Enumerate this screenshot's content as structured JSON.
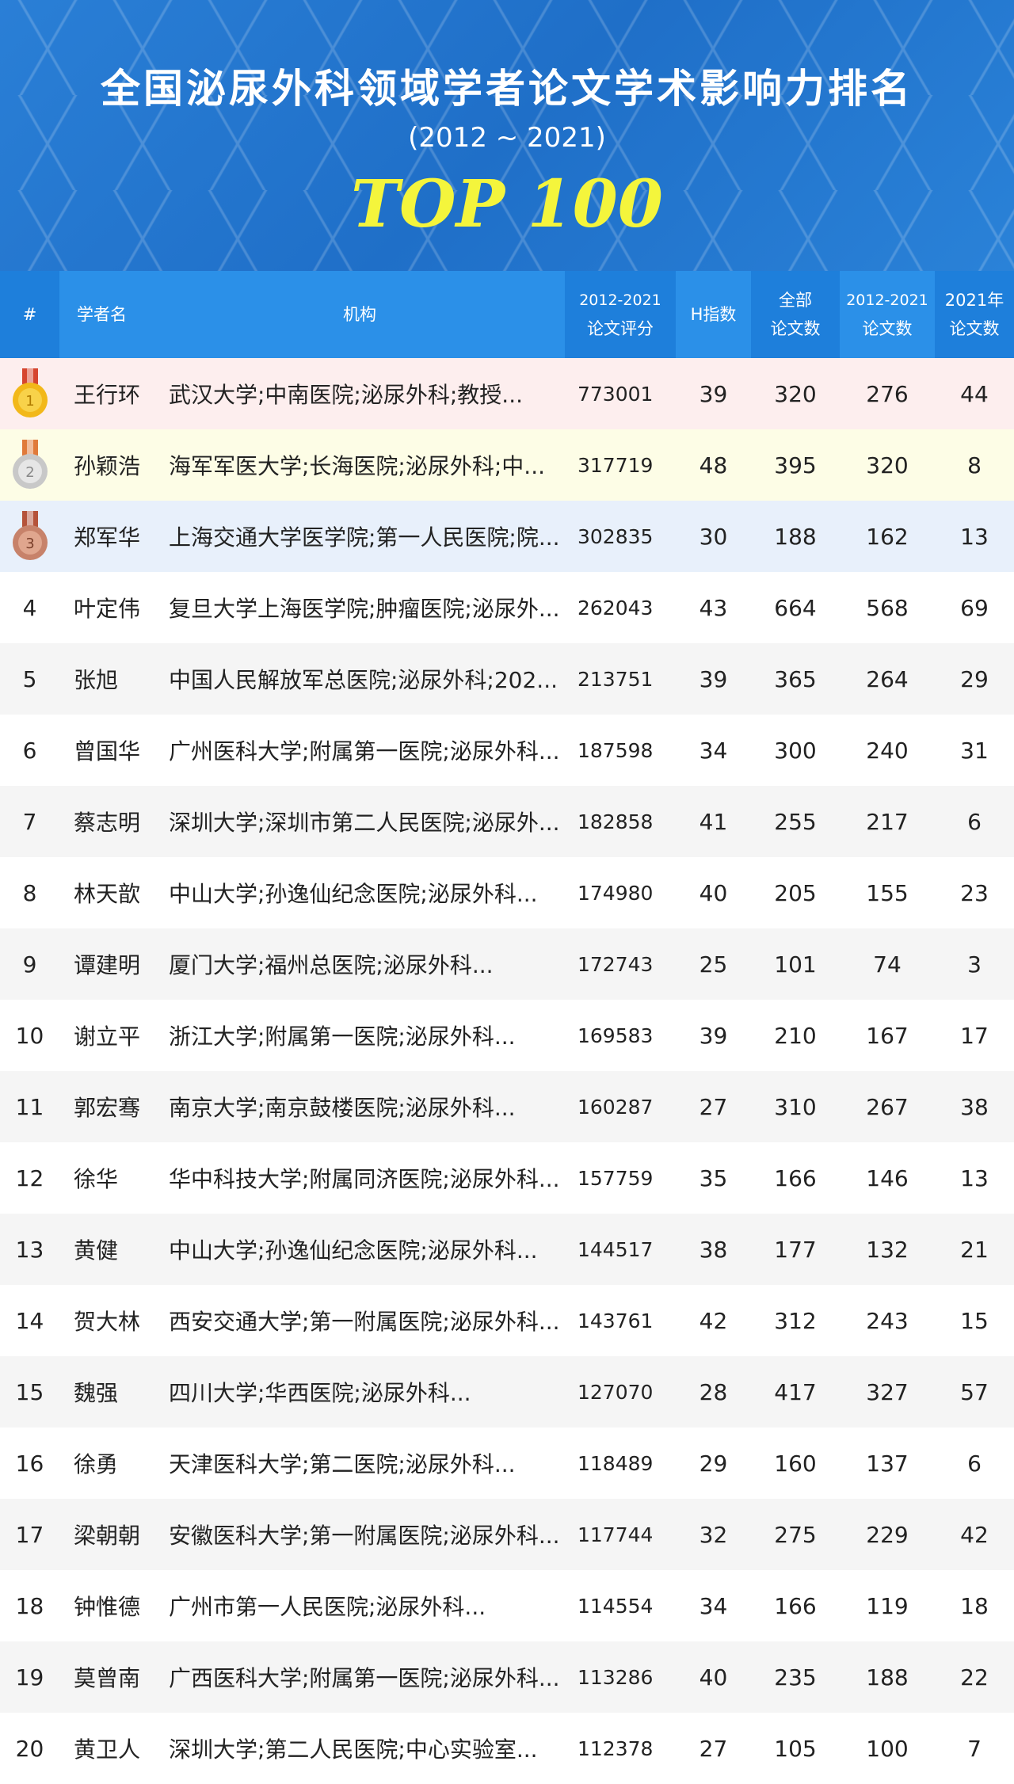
{
  "banner": {
    "title": "全国泌尿外科领域学者论文学术影响力排名",
    "subtitle": "(2012 ~ 2021)",
    "top_label": "TOP 100"
  },
  "colors": {
    "header_bg": "#2b90e8",
    "header_dark": "#1e7fdb",
    "top_text": "#f4f53c",
    "gold_row": "#fdeeee",
    "silver_row": "#fdfde6",
    "bronze_row": "#e8f0fb"
  },
  "table": {
    "headers": {
      "rank": "#",
      "name": "学者名",
      "institution": "机构",
      "score_l1": "2012-2021",
      "score_l2": "论文评分",
      "h_index": "H指数",
      "total_l1": "全部",
      "total_l2": "论文数",
      "period_l1": "2012-2021",
      "period_l2": "论文数",
      "year_l1": "2021年",
      "year_l2": "论文数"
    },
    "rows": [
      {
        "rank": "1",
        "medal": "gold-medal-icon",
        "name": "王行环",
        "institution": "武汉大学;中南医院;泌尿外科;教授...",
        "score": "773001",
        "h_index": "39",
        "total": "320",
        "period": "276",
        "year2021": "44"
      },
      {
        "rank": "2",
        "medal": "silver-medal-icon",
        "name": "孙颖浩",
        "institution": "海军军医大学;长海医院;泌尿外科;中...",
        "score": "317719",
        "h_index": "48",
        "total": "395",
        "period": "320",
        "year2021": "8"
      },
      {
        "rank": "3",
        "medal": "bronze-medal-icon",
        "name": "郑军华",
        "institution": "上海交通大学医学院;第一人民医院;院...",
        "score": "302835",
        "h_index": "30",
        "total": "188",
        "period": "162",
        "year2021": "13"
      },
      {
        "rank": "4",
        "name": "叶定伟",
        "institution": "复旦大学上海医学院;肿瘤医院;泌尿外...",
        "score": "262043",
        "h_index": "43",
        "total": "664",
        "period": "568",
        "year2021": "69"
      },
      {
        "rank": "5",
        "name": "张旭",
        "institution": "中国人民解放军总医院;泌尿外科;202...",
        "score": "213751",
        "h_index": "39",
        "total": "365",
        "period": "264",
        "year2021": "29"
      },
      {
        "rank": "6",
        "name": "曾国华",
        "institution": "广州医科大学;附属第一医院;泌尿外科...",
        "score": "187598",
        "h_index": "34",
        "total": "300",
        "period": "240",
        "year2021": "31"
      },
      {
        "rank": "7",
        "name": "蔡志明",
        "institution": "深圳大学;深圳市第二人民医院;泌尿外...",
        "score": "182858",
        "h_index": "41",
        "total": "255",
        "period": "217",
        "year2021": "6"
      },
      {
        "rank": "8",
        "name": "林天歆",
        "institution": "中山大学;孙逸仙纪念医院;泌尿外科...",
        "score": "174980",
        "h_index": "40",
        "total": "205",
        "period": "155",
        "year2021": "23"
      },
      {
        "rank": "9",
        "name": "谭建明",
        "institution": "厦门大学;福州总医院;泌尿外科...",
        "score": "172743",
        "h_index": "25",
        "total": "101",
        "period": "74",
        "year2021": "3"
      },
      {
        "rank": "10",
        "name": "谢立平",
        "institution": "浙江大学;附属第一医院;泌尿外科...",
        "score": "169583",
        "h_index": "39",
        "total": "210",
        "period": "167",
        "year2021": "17"
      },
      {
        "rank": "11",
        "name": "郭宏骞",
        "institution": "南京大学;南京鼓楼医院;泌尿外科...",
        "score": "160287",
        "h_index": "27",
        "total": "310",
        "period": "267",
        "year2021": "38"
      },
      {
        "rank": "12",
        "name": "徐华",
        "institution": "华中科技大学;附属同济医院;泌尿外科...",
        "score": "157759",
        "h_index": "35",
        "total": "166",
        "period": "146",
        "year2021": "13"
      },
      {
        "rank": "13",
        "name": "黄健",
        "institution": "中山大学;孙逸仙纪念医院;泌尿外科...",
        "score": "144517",
        "h_index": "38",
        "total": "177",
        "period": "132",
        "year2021": "21"
      },
      {
        "rank": "14",
        "name": "贺大林",
        "institution": "西安交通大学;第一附属医院;泌尿外科...",
        "score": "143761",
        "h_index": "42",
        "total": "312",
        "period": "243",
        "year2021": "15"
      },
      {
        "rank": "15",
        "name": "魏强",
        "institution": "四川大学;华西医院;泌尿外科...",
        "score": "127070",
        "h_index": "28",
        "total": "417",
        "period": "327",
        "year2021": "57"
      },
      {
        "rank": "16",
        "name": "徐勇",
        "institution": "天津医科大学;第二医院;泌尿外科...",
        "score": "118489",
        "h_index": "29",
        "total": "160",
        "period": "137",
        "year2021": "6"
      },
      {
        "rank": "17",
        "name": "梁朝朝",
        "institution": "安徽医科大学;第一附属医院;泌尿外科...",
        "score": "117744",
        "h_index": "32",
        "total": "275",
        "period": "229",
        "year2021": "42"
      },
      {
        "rank": "18",
        "name": "钟惟德",
        "institution": "广州市第一人民医院;泌尿外科...",
        "score": "114554",
        "h_index": "34",
        "total": "166",
        "period": "119",
        "year2021": "18"
      },
      {
        "rank": "19",
        "name": "莫曾南",
        "institution": "广西医科大学;附属第一医院;泌尿外科...",
        "score": "113286",
        "h_index": "40",
        "total": "235",
        "period": "188",
        "year2021": "22"
      },
      {
        "rank": "20",
        "name": "黄卫人",
        "institution": "深圳大学;第二人民医院;中心实验室...",
        "score": "112378",
        "h_index": "27",
        "total": "105",
        "period": "100",
        "year2021": "7"
      }
    ]
  }
}
